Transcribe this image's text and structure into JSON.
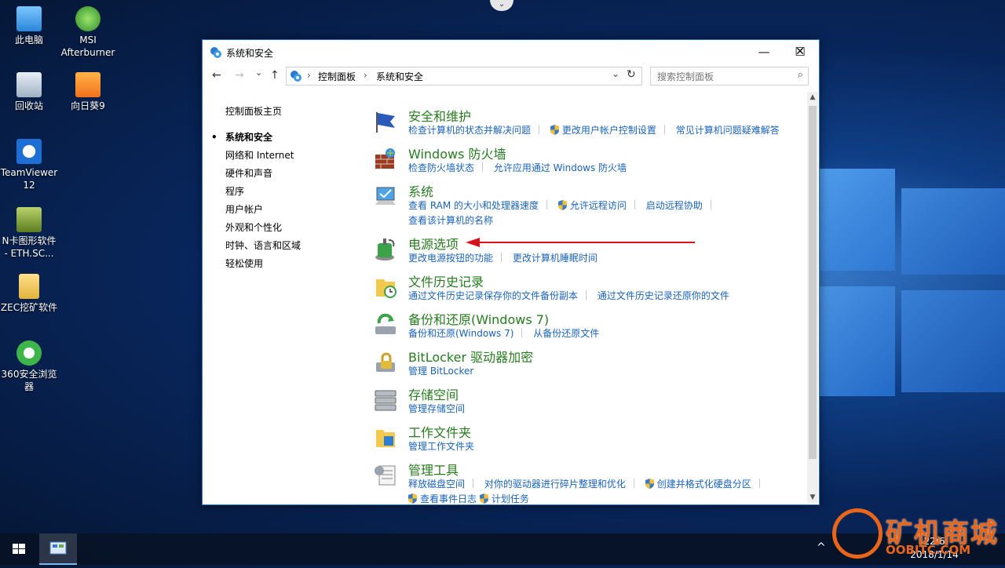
{
  "desktop": {
    "icons": [
      {
        "label": "此电脑"
      },
      {
        "label": "MSI Afterburner"
      },
      {
        "label": "回收站"
      },
      {
        "label": "向日葵9"
      },
      {
        "label": "TeamViewer 12"
      },
      {
        "label": "N卡图形软件 - ETH.SC..."
      },
      {
        "label": "ZEC挖矿软件"
      },
      {
        "label": "360安全浏览器"
      }
    ]
  },
  "window": {
    "title": "系统和安全",
    "controls": {
      "minimize": "—",
      "maximize": "☐",
      "close": "✕"
    },
    "nav": {
      "back": "←",
      "forward": "→",
      "recent": "⌄",
      "up": "↑",
      "refresh": "↻"
    },
    "breadcrumb": [
      "控制面板",
      "系统和安全"
    ],
    "search_placeholder": "搜索控制面板",
    "left_nav": {
      "home": "控制面板主页",
      "items": [
        "系统和安全",
        "网络和 Internet",
        "硬件和声音",
        "程序",
        "用户帐户",
        "外观和个性化",
        "时钟、语言和区域",
        "轻松使用"
      ],
      "current_index": 0
    },
    "categories": [
      {
        "title": "安全和维护",
        "links": [
          "检查计算机的状态并解决问题",
          "更改用户帐户控制设置",
          "常见计算机问题疑难解答"
        ]
      },
      {
        "title": "Windows 防火墙",
        "links": [
          "检查防火墙状态",
          "允许应用通过 Windows 防火墙"
        ]
      },
      {
        "title": "系统",
        "links": [
          "查看 RAM 的大小和处理器速度",
          "允许远程访问",
          "启动远程协助"
        ],
        "links2": [
          "查看该计算机的名称"
        ]
      },
      {
        "title": "电源选项",
        "links": [
          "更改电源按钮的功能",
          "更改计算机睡眠时间"
        ]
      },
      {
        "title": "文件历史记录",
        "links": [
          "通过文件历史记录保存你的文件备份副本",
          "通过文件历史记录还原你的文件"
        ]
      },
      {
        "title": "备份和还原(Windows 7)",
        "links": [
          "备份和还原(Windows 7)",
          "从备份还原文件"
        ]
      },
      {
        "title": "BitLocker 驱动器加密",
        "links": [
          "管理 BitLocker"
        ]
      },
      {
        "title": "存储空间",
        "links": [
          "管理存储空间"
        ]
      },
      {
        "title": "工作文件夹",
        "links": [
          "管理工作文件夹"
        ]
      },
      {
        "title": "管理工具",
        "links": [
          "释放磁盘空间",
          "对你的驱动器进行碎片整理和优化",
          "创建并格式化硬盘分区"
        ],
        "links2": [
          "查看事件日志",
          "计划任务"
        ]
      }
    ]
  },
  "taskbar": {
    "clock_time": "22:6",
    "clock_date": "2018/1/14"
  },
  "watermark": {
    "brand": "矿机商城",
    "site": "OOBITC.COM"
  },
  "colors": {
    "accent": "#2f6fbf",
    "category_title": "#267c1f",
    "link": "#1a63b8",
    "arrow": "#d8121b"
  }
}
